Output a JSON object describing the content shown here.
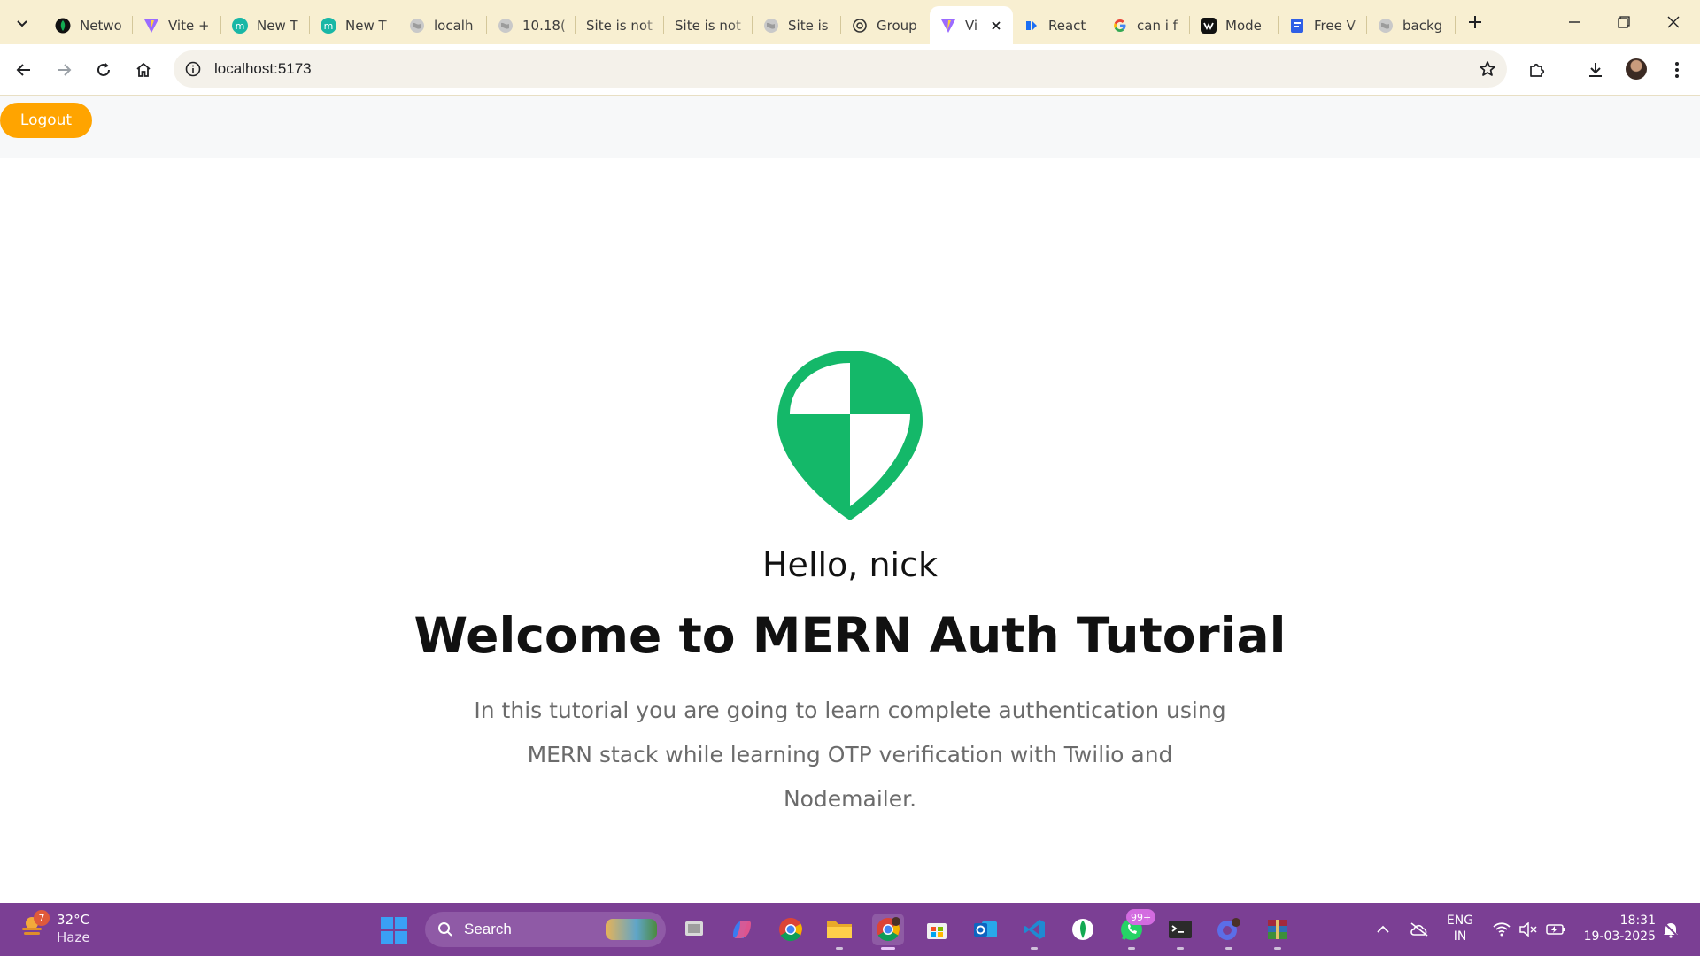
{
  "browser": {
    "tabs": [
      {
        "label": "Netwo",
        "icon": "mongodb-leaf-icon"
      },
      {
        "label": "Vite +",
        "icon": "vite-icon"
      },
      {
        "label": "New T",
        "icon": "m-icon"
      },
      {
        "label": "New T",
        "icon": "m-icon"
      },
      {
        "label": "localh",
        "icon": "globe-icon"
      },
      {
        "label": "10.18(",
        "icon": "globe-icon"
      },
      {
        "label": "Site is not",
        "icon": ""
      },
      {
        "label": "Site is not",
        "icon": ""
      },
      {
        "label": "Site is",
        "icon": "globe-icon"
      },
      {
        "label": "Group",
        "icon": "openai-icon"
      },
      {
        "label": "Vi",
        "icon": "vite-icon",
        "active": true
      },
      {
        "label": "React",
        "icon": "react-icon"
      },
      {
        "label": "can i f",
        "icon": "google-icon"
      },
      {
        "label": "Mode",
        "icon": "vercel-icon"
      },
      {
        "label": "Free V",
        "icon": "docs-icon"
      },
      {
        "label": "backg",
        "icon": "globe-icon"
      }
    ],
    "url": "localhost:5173"
  },
  "page": {
    "logout_label": "Logout",
    "hello": "Hello, nick",
    "title": "Welcome to MERN Auth Tutorial",
    "description": "In this tutorial you are going to learn complete authentication using MERN stack while learning OTP verification with Twilio and Nodemailer."
  },
  "taskbar": {
    "weather_badge": "7",
    "temperature": "32°C",
    "condition": "Haze",
    "search_label": "Search",
    "whatsapp_badge": "99+",
    "lang_line1": "ENG",
    "lang_line2": "IN",
    "time": "18:31",
    "date": "19-03-2025"
  },
  "colors": {
    "tabstrip": "#f8efd1",
    "accent_orange": "#ffa400",
    "shield_green": "#14b869",
    "taskbar": "#7b3f94"
  }
}
